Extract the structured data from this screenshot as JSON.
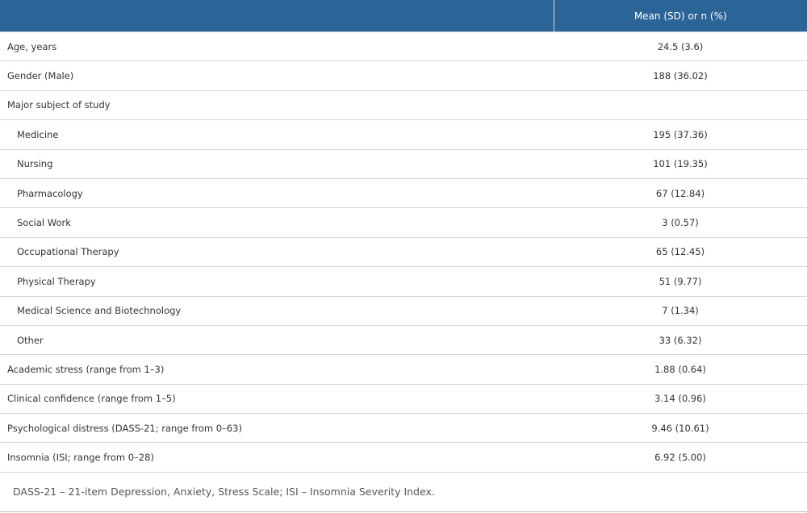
{
  "table": {
    "header": {
      "label_col": "",
      "value_col": "Mean (SD) or n (%)"
    },
    "rows": [
      {
        "label": "Age, years",
        "value": "24.5 (3.6)",
        "indent": false
      },
      {
        "label": "Gender (Male)",
        "value": "188 (36.02)",
        "indent": false
      },
      {
        "label": "Major subject of study",
        "value": "",
        "indent": false
      },
      {
        "label": "Medicine",
        "value": "195 (37.36)",
        "indent": true
      },
      {
        "label": "Nursing",
        "value": "101 (19.35)",
        "indent": true
      },
      {
        "label": "Pharmacology",
        "value": "67 (12.84)",
        "indent": true
      },
      {
        "label": "Social Work",
        "value": "3 (0.57)",
        "indent": true
      },
      {
        "label": "Occupational Therapy",
        "value": "65 (12.45)",
        "indent": true
      },
      {
        "label": "Physical Therapy",
        "value": "51 (9.77)",
        "indent": true
      },
      {
        "label": "Medical Science and Biotechnology",
        "value": "7 (1.34)",
        "indent": true
      },
      {
        "label": "Other",
        "value": "33 (6.32)",
        "indent": true
      },
      {
        "label": "Academic stress (range from 1–3)",
        "value": "1.88 (0.64)",
        "indent": false
      },
      {
        "label": "Clinical confidence (range from 1–5)",
        "value": "3.14 (0.96)",
        "indent": false
      },
      {
        "label": "Psychological distress (DASS-21; range from 0–63)",
        "value": "9.46 (10.61)",
        "indent": false
      },
      {
        "label": "Insomnia (ISI; range from 0–28)",
        "value": "6.92 (5.00)",
        "indent": false
      }
    ],
    "footnote": "DASS-21 – 21-item Depression, Anxiety, Stress Scale; ISI – Insomnia Severity Index."
  },
  "colors": {
    "header_bg": "#2b6496",
    "header_text": "#ffffff",
    "row_border": "#d6d6d6"
  }
}
